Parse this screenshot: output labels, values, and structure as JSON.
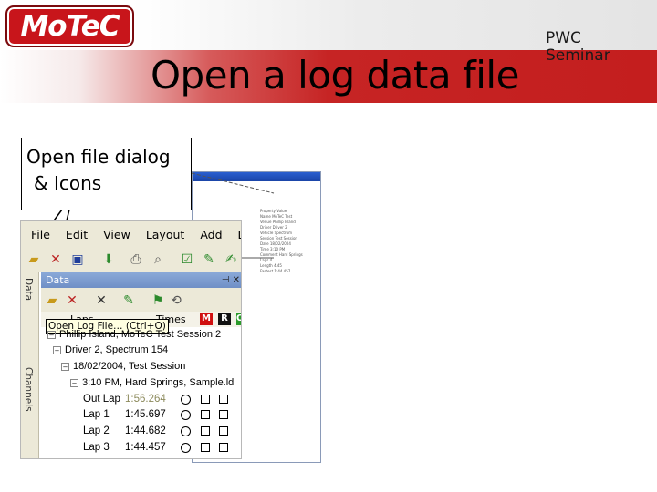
{
  "header": {
    "logo_text": "MoTeC",
    "title": "Open a log data file",
    "badge_line1": "PWC",
    "badge_line2": "Seminar"
  },
  "callout": {
    "line1": "Open file dialog",
    "line2": "&  Icons"
  },
  "app": {
    "menu": [
      "File",
      "Edit",
      "View",
      "Layout",
      "Add",
      "Data"
    ],
    "side_tabs": [
      "Data",
      "Channels"
    ],
    "panel_title": "Data",
    "col_laps": "Laps",
    "col_times": "Times",
    "badges": [
      "M",
      "R",
      "O"
    ],
    "tooltip": "Open Log File… (Ctrl+O)",
    "tree": {
      "session": "Phillip Island, MoTeC Test Session 2",
      "driver": "Driver 2, Spectrum 154",
      "date": "18/02/2004, Test Session",
      "file": "3:10 PM, Hard Springs, Sample.ld"
    },
    "laps": [
      {
        "name": "Out Lap",
        "time": "1:56.264"
      },
      {
        "name": "Lap 1",
        "time": "1:45.697"
      },
      {
        "name": "Lap 2",
        "time": "1:44.682"
      },
      {
        "name": "Lap 3",
        "time": "1:44.457"
      }
    ]
  },
  "colors": {
    "brand_red": "#c41e1e",
    "title_bar_blue": "#6f8fc6",
    "tooltip_bg": "#ffffe1"
  }
}
